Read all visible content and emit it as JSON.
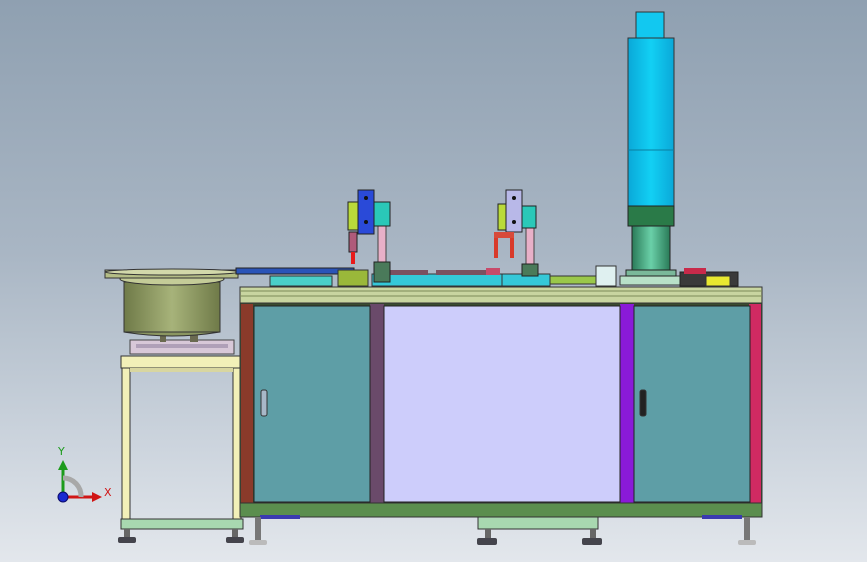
{
  "viewport": {
    "background_top": "#8fa0b1",
    "background_bottom": "#e3e7ec"
  },
  "axis_triad": {
    "x_label": "X",
    "y_label": "Y",
    "x_color": "#d01515",
    "y_color": "#1c9b1c",
    "z_color": "#1a2ad0"
  },
  "colors": {
    "cabinet_panel": "#5e9ea6",
    "center_panel": "#cdcdfb",
    "tabletop": "#c8d5a0",
    "column": "#12c8f0",
    "bowl": "#9aa86a",
    "stand_frame": "#f2f0b8",
    "rail": "#34c8d8"
  },
  "icons": [
    "vibratory-bowl-feeder",
    "pick-and-place-unit",
    "press-column",
    "cabinet-door-handle",
    "leveling-foot",
    "coordinate-triad-icon"
  ]
}
